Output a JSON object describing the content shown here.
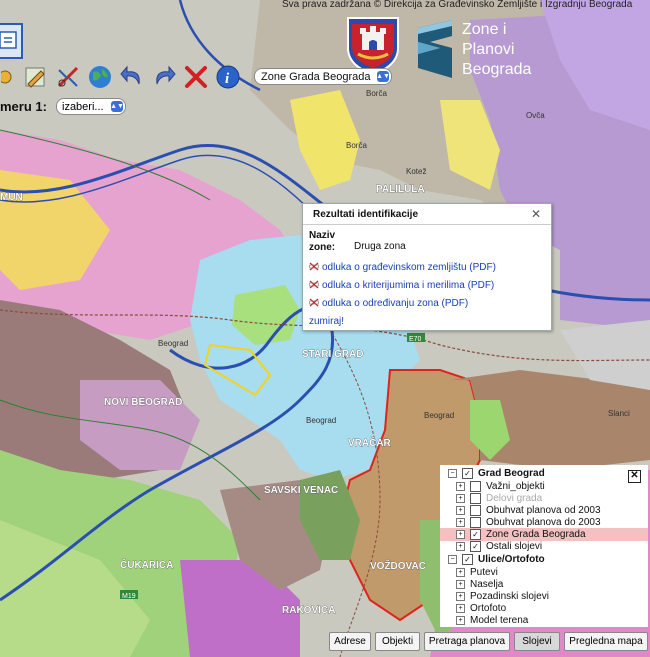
{
  "header": {
    "copyright": "Sva prava zadržana © Direkcija za Građevinsko Zemljište i Izgradnju Beograda",
    "logo_lines": [
      "Zone i",
      "Planovi",
      "Beograda"
    ]
  },
  "toolbar": {
    "icons": [
      "map-window-icon",
      "pencil-icon",
      "measure-tool-icon",
      "globe-icon",
      "undo-arrow-icon",
      "redo-arrow-icon",
      "clear-x-icon",
      "info-icon"
    ],
    "zone_select": "Zone Grada Beograda",
    "scale_label": "meru 1:",
    "scale_select": "izaberi..."
  },
  "map": {
    "places": {
      "palilula": "PALILULA",
      "novi_beograd": "NOVI BEOGRAD",
      "stari_grad": "STARI GRAD",
      "vracar": "VRAČAR",
      "savski_venac": "SAVSKI VENAC",
      "cukarica": "ČUKARICA",
      "vozdovac": "VOŽDOVAC",
      "rakovica": "RAKOVICA",
      "zemun": "MUN"
    },
    "small_labels": {
      "beograd1": "Beograd",
      "beograd2": "Beograd",
      "beograd3": "Beograd",
      "borca1": "Borča",
      "borca2": "Borča",
      "kotez": "Kotež",
      "ovca": "Ovča",
      "slanci": "Slanci",
      "e70": "E70",
      "m19": "M19"
    }
  },
  "popup": {
    "title": "Rezultati identifikacije",
    "label_line1": "Naziv",
    "label_line2": "zone:",
    "value": "Druga zona",
    "links": [
      "odluka o građevinskom zemljištu (PDF)",
      "odluka o kriterijumima i merilima (PDF)",
      "odluka o određivanju zona (PDF)"
    ],
    "zoom": "zumiraj!"
  },
  "layers": {
    "group1": "Grad Beograd",
    "items1": [
      "Važni_objekti",
      "Delovi grada",
      "Obuhvat planova od 2003",
      "Obuhvat planova do 2003",
      "Zone Grada Beograda",
      "Ostali slojevi"
    ],
    "group2": "Ulice/Ortofoto",
    "items2": [
      "Putevi",
      "Naselja",
      "Pozadinski slojevi",
      "Ortofoto",
      "Model terena"
    ]
  },
  "tabs": [
    "Adrese",
    "Objekti",
    "Pretraga planova",
    "Slojevi",
    "Pregledna mapa"
  ],
  "colors": {
    "river": "#2b4fb0",
    "highlight_zone": "#e0241a",
    "selected_layer_row": "#f4c0c0"
  }
}
